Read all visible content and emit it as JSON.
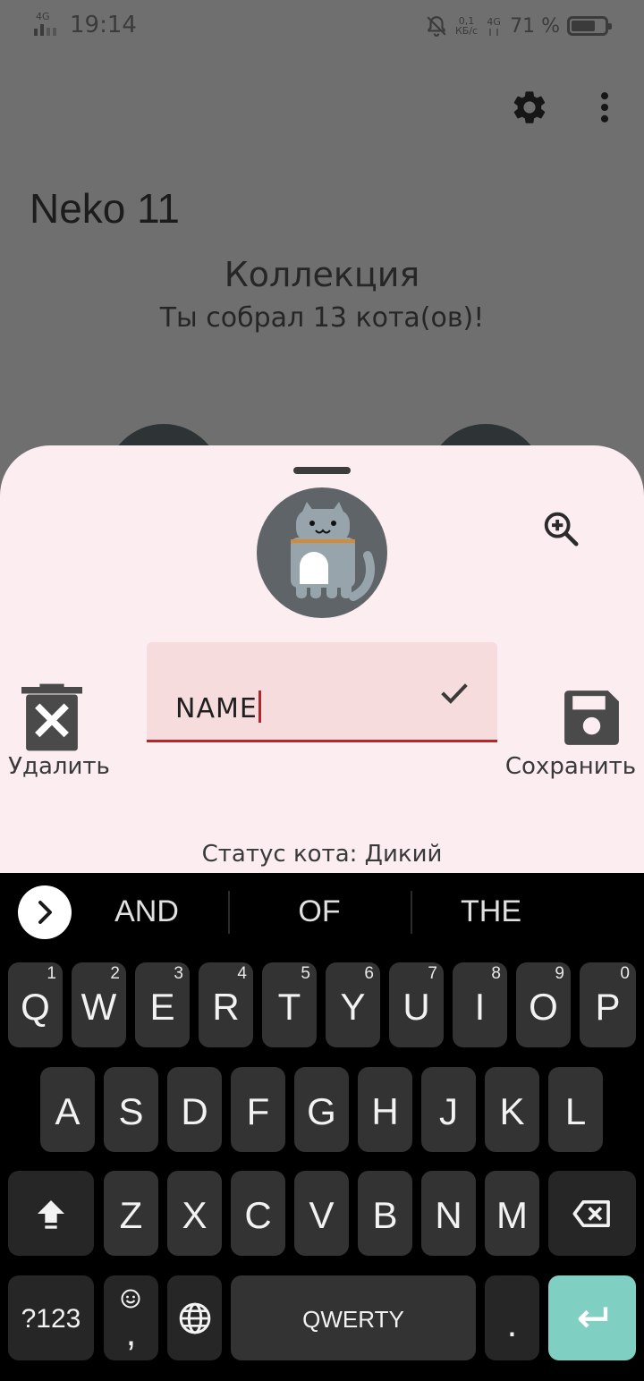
{
  "status_bar": {
    "network_left": "4G",
    "time": "19:14",
    "speed_value": "0,1",
    "speed_unit": "КБ/с",
    "network_right": "4G",
    "battery_text": "71 %",
    "battery_level": 0.71
  },
  "app": {
    "title": "Neko 11",
    "collection_title": "Коллекция",
    "collection_subtitle": "Ты собрал 13 кота(ов)!"
  },
  "sheet": {
    "delete_label": "Удалить",
    "save_label": "Сохранить",
    "name_value": "NAME",
    "status_text": "Статус кота: Дикий"
  },
  "keyboard": {
    "suggestions": [
      "AND",
      "OF",
      "THE"
    ],
    "row1": [
      {
        "key": "Q",
        "hint": "1"
      },
      {
        "key": "W",
        "hint": "2"
      },
      {
        "key": "E",
        "hint": "3"
      },
      {
        "key": "R",
        "hint": "4"
      },
      {
        "key": "T",
        "hint": "5"
      },
      {
        "key": "Y",
        "hint": "6"
      },
      {
        "key": "U",
        "hint": "7"
      },
      {
        "key": "I",
        "hint": "8"
      },
      {
        "key": "O",
        "hint": "9"
      },
      {
        "key": "P",
        "hint": "0"
      }
    ],
    "row2": [
      "A",
      "S",
      "D",
      "F",
      "G",
      "H",
      "J",
      "K",
      "L"
    ],
    "row3": [
      "Z",
      "X",
      "C",
      "V",
      "B",
      "N",
      "M"
    ],
    "symbols_label": "?123",
    "comma_label": ",",
    "space_label": "QWERTY",
    "period_label": "."
  },
  "colors": {
    "sheet_bg": "#fcedf1",
    "field_bg": "#f6dcdc",
    "accent_underline": "#b3262a",
    "enter_key": "#80cfc3",
    "key_bg": "#333333"
  },
  "icons": {
    "settings": "gear-icon",
    "overflow": "more-vert-icon",
    "zoom": "zoom-in-icon",
    "delete": "trash-icon",
    "save": "floppy-icon",
    "confirm": "check-icon",
    "shift": "shift-icon",
    "backspace": "backspace-icon",
    "globe": "globe-icon",
    "emoji": "emoji-icon",
    "enter": "enter-icon",
    "expand_suggestions": "chevron-right-icon"
  }
}
